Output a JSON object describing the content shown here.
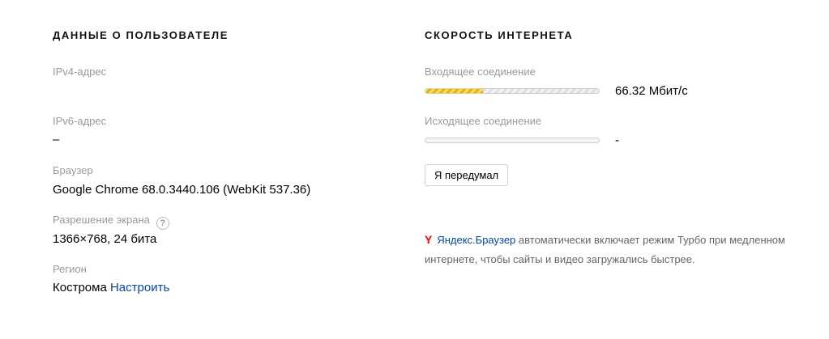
{
  "user": {
    "title": "ДАННЫЕ О ПОЛЬЗОВАТЕЛЕ",
    "ipv4": {
      "label": "IPv4-адрес",
      "value": ""
    },
    "ipv6": {
      "label": "IPv6-адрес",
      "value": "–"
    },
    "browser": {
      "label": "Браузер",
      "value": "Google Chrome 68.0.3440.106 (WebKit 537.36)"
    },
    "resolution": {
      "label": "Разрешение экрана",
      "help": "?",
      "value": "1366×768, 24 бита"
    },
    "region": {
      "label": "Регион",
      "value": "Кострома",
      "link": "Настроить"
    }
  },
  "speed": {
    "title": "СКОРОСТЬ ИНТЕРНЕТА",
    "incoming": {
      "label": "Входящее соединение",
      "value": "66.32 Мбит/с",
      "progress": 0.33
    },
    "outgoing": {
      "label": "Исходящее соединение",
      "value": "-",
      "progress": 0
    },
    "cancel_button": "Я передумал",
    "promo": {
      "icon": "Y",
      "link": "Яндекс.Браузер",
      "text": " автоматически включает режим Турбо при медленном интернете, чтобы сайты и видео загружались быстрее."
    }
  }
}
